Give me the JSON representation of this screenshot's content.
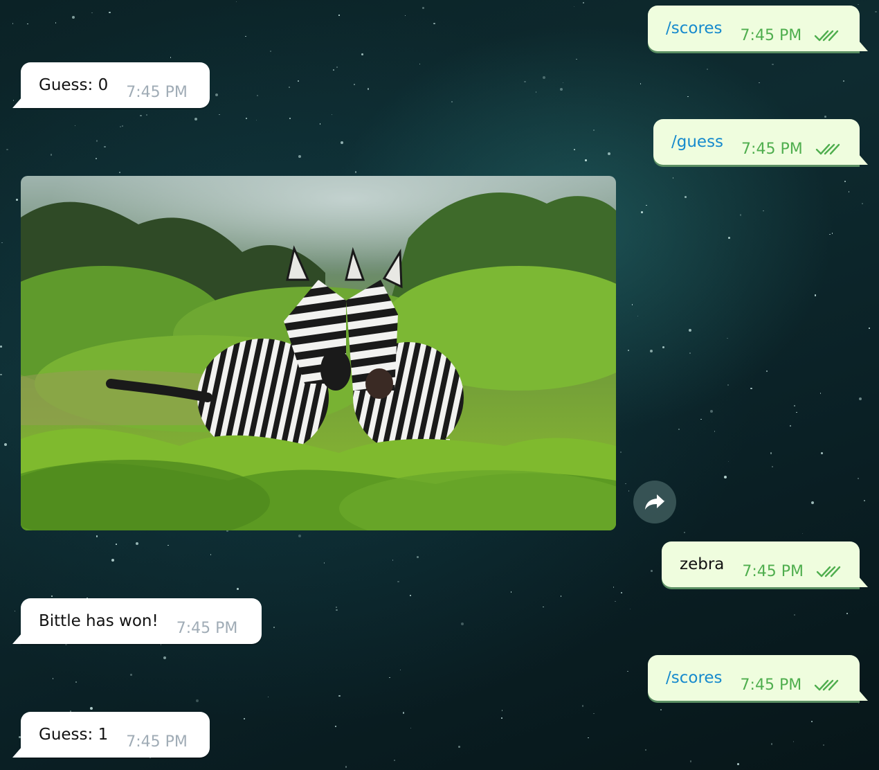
{
  "chat": {
    "messages": [
      {
        "id": "m1",
        "direction": "out",
        "text": "/scores",
        "time": "7:45 PM",
        "status": "read"
      },
      {
        "id": "m2",
        "direction": "in",
        "text": "Guess: 0",
        "time": "7:45 PM"
      },
      {
        "id": "m3",
        "direction": "out",
        "text": "/guess",
        "time": "7:45 PM",
        "status": "read"
      },
      {
        "id": "m4",
        "direction": "in",
        "type": "photo",
        "photo_icon": "zebra-photo"
      },
      {
        "id": "m5",
        "direction": "out",
        "text": "zebra",
        "time": "7:45 PM",
        "status": "read"
      },
      {
        "id": "m6",
        "direction": "in",
        "text": "Bittle has won!",
        "time": "7:45 PM"
      },
      {
        "id": "m7",
        "direction": "out",
        "text": "/scores",
        "time": "7:45 PM",
        "status": "read"
      },
      {
        "id": "m8",
        "direction": "in",
        "text": "Guess: 1",
        "time": "7:45 PM"
      }
    ],
    "share_icon": "share-arrow-icon",
    "colors": {
      "incoming_bubble": "#ffffff",
      "outgoing_bubble": "#effdde",
      "command_text": "#168acd",
      "outgoing_time": "#4fae4e",
      "incoming_time": "#a0acb6"
    }
  }
}
